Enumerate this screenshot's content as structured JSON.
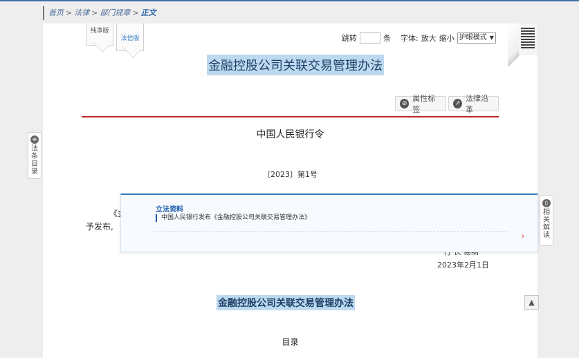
{
  "breadcrumb": {
    "home": "首页",
    "law": "法律",
    "rules": "部门规章",
    "current": "正文",
    "sep": ">"
  },
  "version_tabs": {
    "plain": "纯净版",
    "faxin": "法信版"
  },
  "toolbar": {
    "jump_label": "跳转",
    "jump_unit": "条",
    "font_label": "字体:",
    "font_larger": "放大",
    "font_smaller": "缩小",
    "mode_selected": "护眼模式"
  },
  "doc": {
    "title": "金融控股公司关联交易管理办法",
    "attr_button": "属性标签",
    "history_button": "法律沿革",
    "order": "中国人民银行令",
    "doc_number": "〔2023〕第1号",
    "line1_start": "《金",
    "line2_start": "予发布,",
    "sign_fragment": "行  长  易纲",
    "sign_date": "2023年2月1日",
    "title2": "金融控股公司关联交易管理办法",
    "toc": "目录"
  },
  "popup": {
    "section_title": "立法资料",
    "item": "中国人民银行发布《金融控股公司关联交易管理办法》"
  },
  "side": {
    "left_label": "法条目录",
    "right_label": "相关解读"
  },
  "colors": {
    "accent": "#2f7cc2",
    "highlight": "#bcd9f0",
    "redline": "#c0262d"
  }
}
